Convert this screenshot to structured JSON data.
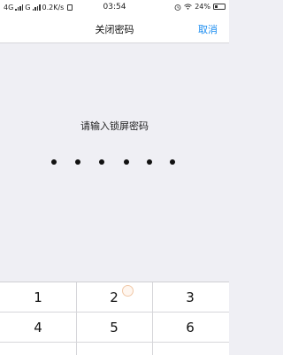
{
  "status_bar": {
    "network_left": "4G",
    "network_right": "G",
    "speed": "0.2K/s",
    "time": "03:54",
    "battery": "24%"
  },
  "nav": {
    "title": "关闭密码",
    "cancel": "取消"
  },
  "prompt": "请输入锁屏密码",
  "passcode": {
    "entered_digits": 6
  },
  "keypad": {
    "keys": [
      "1",
      "2",
      "3",
      "4",
      "5",
      "6"
    ]
  },
  "colors": {
    "accent": "#1a8cf0",
    "background": "#efeff4"
  }
}
